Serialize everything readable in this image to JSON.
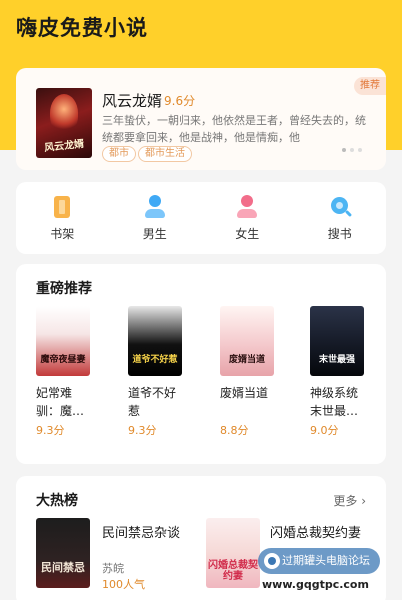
{
  "app": {
    "title": "嗨皮免费小说"
  },
  "featured": {
    "title": "风云龙婿",
    "score": "9.6分",
    "description": "三年蛰伏，一朝归来，他依然是王者，曾经失去的，统统都要拿回来，他是战神，他是情痴，他",
    "tags": [
      "都市",
      "都市生活"
    ],
    "badge": "推荐",
    "cover_text": "风云龙婿"
  },
  "nav": {
    "items": [
      {
        "label": "书架",
        "icon": "bookshelf-icon"
      },
      {
        "label": "男生",
        "icon": "male-icon"
      },
      {
        "label": "女生",
        "icon": "female-icon"
      },
      {
        "label": "搜书",
        "icon": "search-icon"
      }
    ]
  },
  "recommend": {
    "title": "重磅推荐",
    "books": [
      {
        "name": "妃常难驯：魔…",
        "score": "9.3分",
        "cover_text": "魔帝夜昼妻"
      },
      {
        "name": "道爷不好惹",
        "score": "9.3分",
        "cover_text": "道爷不好惹"
      },
      {
        "name": "废婿当道",
        "score": "8.8分",
        "cover_text": "废婿当道"
      },
      {
        "name": "神级系统末世最…",
        "score": "9.0分",
        "cover_text": "末世最强"
      }
    ]
  },
  "hot": {
    "title": "大热榜",
    "more": "更多 ›",
    "books": [
      {
        "title": "民间禁忌杂谈",
        "author": "苏皖",
        "popularity": "100人气",
        "cover_text": "民间禁忌"
      },
      {
        "title": "闪婚总裁契约妻",
        "cover_text": "闪婚总裁契约妻"
      }
    ]
  },
  "watermark": {
    "text": "过期罐头电脑论坛",
    "url": "www.gqgtpc.com"
  }
}
